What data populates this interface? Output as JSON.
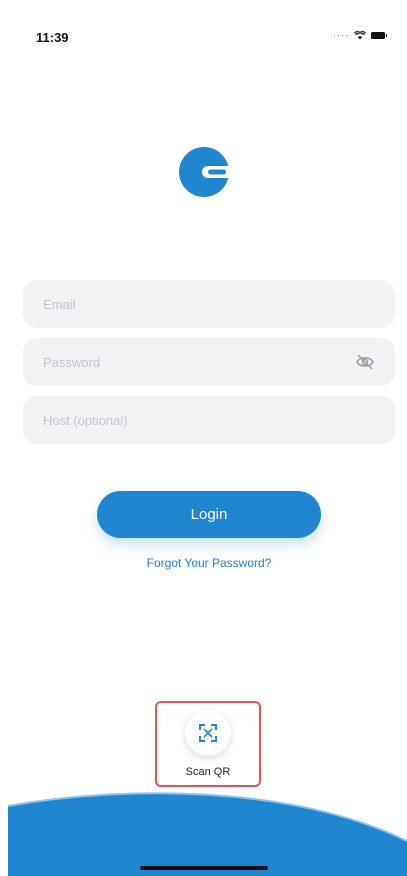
{
  "status_bar": {
    "time": "11:39",
    "signal_dots": "····",
    "icons": [
      "wifi-icon",
      "battery-icon"
    ]
  },
  "logo": {
    "icon": "app-logo-icon",
    "color": "#1f86cf"
  },
  "form": {
    "email": {
      "value": "",
      "placeholder": "Email"
    },
    "password": {
      "value": "",
      "placeholder": "Password",
      "toggle_icon": "eye-slash-icon"
    },
    "host": {
      "value": "",
      "placeholder": "Host (optional)"
    }
  },
  "login_button": {
    "label": "Login",
    "color": "#1f86cf"
  },
  "forgot_password": {
    "label": "Forgot Your Password?"
  },
  "scan_qr": {
    "label": "Scan QR",
    "icon": "qr-scan-icon",
    "highlight_color": "#e0525e"
  },
  "footer": {
    "wave_color": "#1f86cf"
  }
}
